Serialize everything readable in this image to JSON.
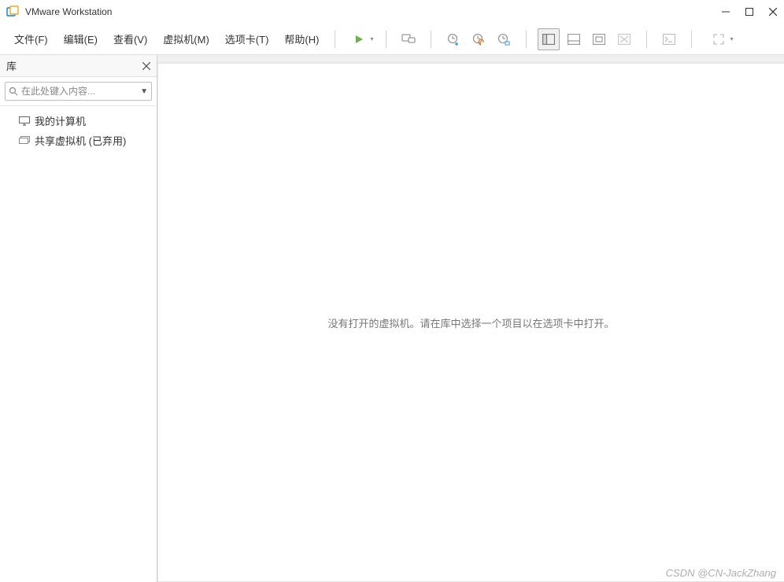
{
  "window": {
    "title": "VMware Workstation"
  },
  "menu": {
    "file": "文件(F)",
    "edit": "编辑(E)",
    "view": "查看(V)",
    "vm": "虚拟机(M)",
    "tabs": "选项卡(T)",
    "help": "帮助(H)"
  },
  "toolbar": {
    "power_on": "power-on",
    "send_ctrl_alt_del": "send-ctrl-alt-del",
    "snapshot": "snapshot",
    "revert": "revert-snapshot",
    "manage_snapshot": "manage-snapshots",
    "show_library": "show-library",
    "thumbnail": "thumbnail-view",
    "fullscreen": "fullscreen",
    "unity": "unity-mode",
    "console": "console-view",
    "stretch": "stretch-guest"
  },
  "sidebar": {
    "title": "库",
    "search_placeholder": "在此处键入内容...",
    "items": [
      {
        "label": "我的计算机",
        "icon": "monitor-icon"
      },
      {
        "label": "共享虚拟机 (已弃用)",
        "icon": "shared-vm-icon"
      }
    ]
  },
  "content": {
    "empty_message": "没有打开的虚拟机。请在库中选择一个项目以在选项卡中打开。"
  },
  "watermark": "CSDN @CN-JackZhang"
}
